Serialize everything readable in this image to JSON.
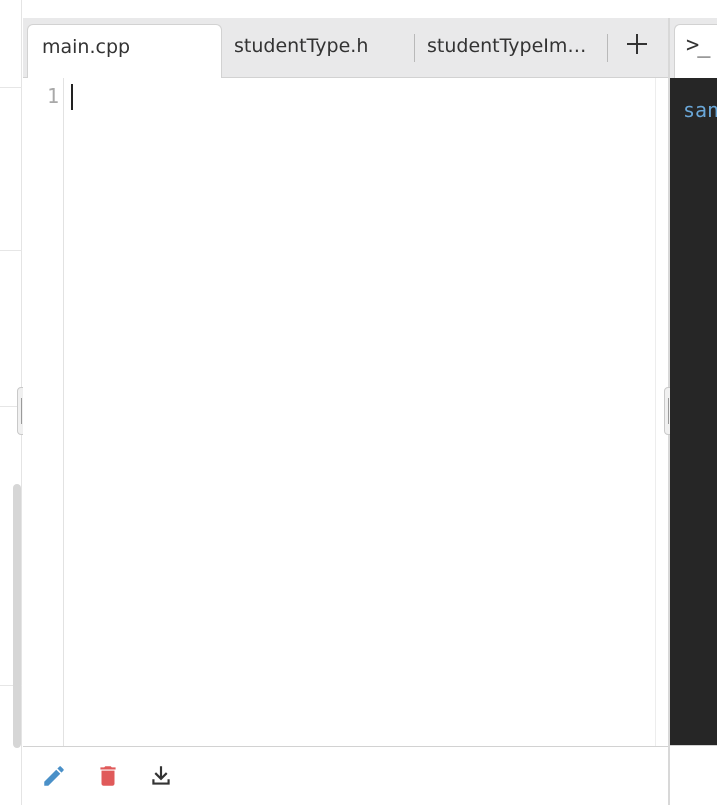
{
  "tabs": [
    {
      "label": "main.cpp",
      "active": true
    },
    {
      "label": "studentType.h",
      "active": false
    },
    {
      "label": "studentTypeIm…",
      "active": false
    }
  ],
  "add_tab": {
    "icon": "plus-icon"
  },
  "editor": {
    "line_numbers": [
      "1"
    ],
    "content": ""
  },
  "console": {
    "tab_symbol": ">_",
    "text": "san"
  },
  "toolbar": {
    "edit_icon": "pencil-icon",
    "delete_icon": "trash-icon",
    "download_icon": "download-icon"
  },
  "colors": {
    "pencil": "#4a90c8",
    "trash": "#e05a5a",
    "download": "#333333",
    "console_bg": "#262626",
    "console_text": "#6aa7d8",
    "tab_bar_bg": "#e9e9ea"
  }
}
